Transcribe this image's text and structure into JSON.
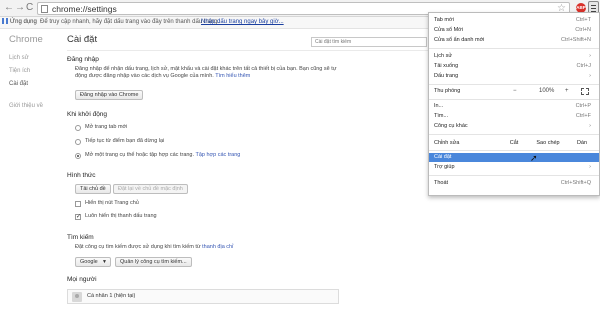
{
  "toolbar": {
    "back": "←",
    "forward": "→",
    "reload": "C",
    "url": "chrome://settings",
    "star": "☆",
    "ext_badge": "ABP"
  },
  "bookmarks": {
    "apps_label": "Ứng dụng",
    "hint": "Để truy cập nhanh, hãy đặt dấu trang vào đây trên thanh dấu trang.",
    "link": "Nhập dấu trang ngay bây giờ..."
  },
  "sidebar": {
    "title": "Chrome",
    "items": [
      "Lịch sử",
      "Tiện ích",
      "Cài đặt",
      "Giới thiệu về"
    ]
  },
  "main": {
    "title": "Cài đặt",
    "search_placeholder": "Cài đặt tìm kiếm",
    "signin": {
      "heading": "Đăng nhập",
      "line1": "Đăng nhập để nhận dấu trang, lịch sử, mật khẩu và cài đặt khác trên tất cả thiết bị của bạn. Bạn cũng sẽ tự động",
      "line2": "được đăng nhập vào các dịch vụ Google của mình.",
      "learn_more": "Tìm hiểu thêm",
      "button": "Đăng nhập vào Chrome"
    },
    "startup": {
      "heading": "Khi khởi động",
      "options": [
        "Mở trang tab mới",
        "Tiếp tục từ điểm bạn đã dừng lại",
        "Mở một trang cụ thể hoặc tập hợp các trang."
      ],
      "set_pages": "Tập hợp các trang"
    },
    "appearance": {
      "heading": "Hình thức",
      "theme_button": "Tải chủ đề",
      "reset_button": "Đặt lại về chủ đề mặc định",
      "show_home": "Hiển thị nút Trang chủ",
      "show_bookmarks": "Luôn hiển thị thanh dấu trang"
    },
    "search": {
      "heading": "Tìm kiếm",
      "desc": "Đặt công cụ tìm kiếm được sử dụng khi tìm kiếm từ",
      "omnibox_link": "thanh địa chỉ",
      "engine": "Google",
      "manage_button": "Quản lý công cụ tìm kiếm..."
    },
    "people": {
      "heading": "Mọi người",
      "person": "Cá nhân 1 (hiện tại)"
    }
  },
  "menu": {
    "new_tab": "Tab mới",
    "new_tab_sc": "Ctrl+T",
    "new_window": "Cửa sổ Mới",
    "new_window_sc": "Ctrl+N",
    "incognito": "Cửa sổ ẩn danh mới",
    "incognito_sc": "Ctrl+Shift+N",
    "history": "Lịch sử",
    "downloads": "Tải xuống",
    "downloads_sc": "Ctrl+J",
    "bookmarks": "Dấu trang",
    "zoom": "Thu phóng",
    "zoom_minus": "−",
    "zoom_value": "100%",
    "zoom_plus": "+",
    "print": "In...",
    "print_sc": "Ctrl+P",
    "find": "Tìm...",
    "find_sc": "Ctrl+F",
    "more_tools": "Công cụ khác",
    "edit": "Chỉnh sửa",
    "cut": "Cắt",
    "copy": "Sao chép",
    "paste": "Dán",
    "settings": "Cài đặt",
    "help": "Trợ giúp",
    "exit": "Thoát",
    "exit_sc": "Ctrl+Shift+Q",
    "arrow": "›"
  },
  "colors": {
    "menu_highlight": "#4a87db",
    "link": "#3556b3"
  }
}
